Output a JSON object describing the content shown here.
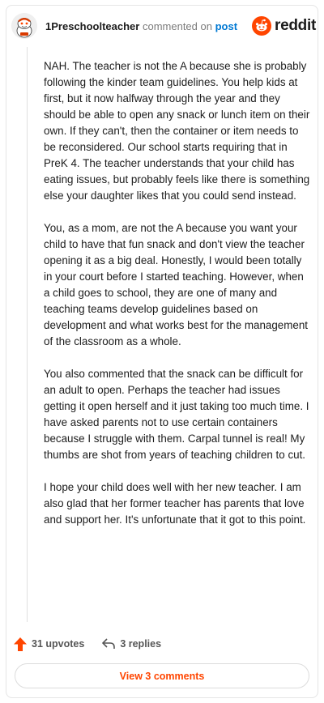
{
  "header": {
    "username": "1Preschoolteacher",
    "verb": "commented on",
    "post_link": "post",
    "brand": "reddit"
  },
  "comment": {
    "paragraphs": [
      "NAH. The teacher is not the A because she is probably following the kinder team guidelines. You help kids at first, but it now halfway through the year and they should be able to open any snack or lunch item on their own. If they can't, then the container or item needs to be reconsidered. Our school starts requiring that in PreK 4. The teacher understands that your child has eating issues, but probably feels like there is something else your daughter likes that you could send instead.",
      "You, as a mom, are not the A because you want your child to have that fun snack and don't view the teacher opening it as a big deal. Honestly, I would been totally in your court before I started teaching. However, when a child goes to school, they are one of many and teaching teams develop guidelines based on development and what works best for the management of the classroom as a whole.",
      "You also commented that the snack can be difficult for an adult to open. Perhaps the teacher had issues getting it open herself and it just taking too much time. I have asked parents not to use certain containers because I struggle with them. Carpal tunnel is real! My thumbs are shot from years of teaching children to cut.",
      "I hope your child does well with her new teacher. I am also glad that her former teacher has parents that love and support her. It's unfortunate that it got to this point."
    ]
  },
  "actions": {
    "upvotes": "31 upvotes",
    "replies": "3 replies"
  },
  "view_comments_label": "View 3 comments",
  "icons": {
    "avatar": "snoo-avatar-icon",
    "brand": "reddit-logo-icon",
    "upvote": "upvote-arrow-icon",
    "reply": "reply-arrow-icon"
  },
  "colors": {
    "accent": "#ff4500",
    "link": "#0079d3",
    "text": "#1c1c1c",
    "muted": "#7c7c7c"
  }
}
